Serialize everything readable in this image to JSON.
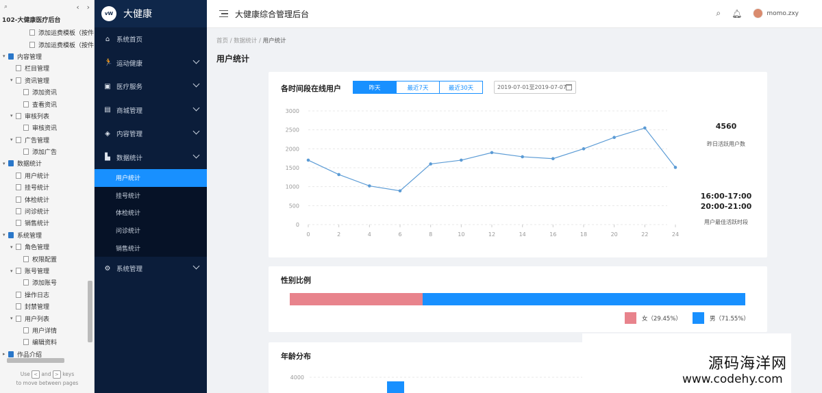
{
  "tree": {
    "project": "102-大健康医疗后台",
    "nodes": [
      {
        "label": "添加运费模板（按件",
        "level": 3,
        "type": "page"
      },
      {
        "label": "添加运费模板（按件",
        "level": 3,
        "type": "page"
      },
      {
        "label": "内容管理",
        "level": 0,
        "type": "folder",
        "toggle": "▾"
      },
      {
        "label": "栏目管理",
        "level": 1,
        "type": "page"
      },
      {
        "label": "资讯管理",
        "level": 1,
        "type": "page",
        "toggle": "▾"
      },
      {
        "label": "添加资讯",
        "level": 2,
        "type": "page"
      },
      {
        "label": "查看资讯",
        "level": 2,
        "type": "page"
      },
      {
        "label": "审核列表",
        "level": 1,
        "type": "page",
        "toggle": "▾"
      },
      {
        "label": "审核资讯",
        "level": 2,
        "type": "page"
      },
      {
        "label": "广告管理",
        "level": 1,
        "type": "page",
        "toggle": "▾"
      },
      {
        "label": "添加广告",
        "level": 2,
        "type": "page"
      },
      {
        "label": "数据统计",
        "level": 0,
        "type": "folder",
        "toggle": "▾"
      },
      {
        "label": "用户统计",
        "level": 1,
        "type": "page"
      },
      {
        "label": "挂号统计",
        "level": 1,
        "type": "page"
      },
      {
        "label": "体检统计",
        "level": 1,
        "type": "page"
      },
      {
        "label": "问诊统计",
        "level": 1,
        "type": "page"
      },
      {
        "label": "销售统计",
        "level": 1,
        "type": "page"
      },
      {
        "label": "系统管理",
        "level": 0,
        "type": "folder",
        "toggle": "▾"
      },
      {
        "label": "角色管理",
        "level": 1,
        "type": "page",
        "toggle": "▾"
      },
      {
        "label": "权限配置",
        "level": 2,
        "type": "page"
      },
      {
        "label": "账号管理",
        "level": 1,
        "type": "page",
        "toggle": "▾"
      },
      {
        "label": "添加账号",
        "level": 2,
        "type": "page"
      },
      {
        "label": "操作日志",
        "level": 1,
        "type": "page"
      },
      {
        "label": "封禁管理",
        "level": 1,
        "type": "page"
      },
      {
        "label": "用户列表",
        "level": 1,
        "type": "page",
        "toggle": "▾"
      },
      {
        "label": "用户详情",
        "level": 2,
        "type": "page"
      },
      {
        "label": "编辑资料",
        "level": 2,
        "type": "page"
      },
      {
        "label": "作品介绍",
        "level": 0,
        "type": "folder",
        "toggle": "▸"
      }
    ],
    "footer_use": "Use",
    "footer_and": "and",
    "footer_keys": "keys",
    "footer_line2": "to move between pages",
    "key_left": "<",
    "key_right": ">"
  },
  "sidebar": {
    "brand": "大健康",
    "logo_text": "vW",
    "items_top": [
      {
        "label": "系统首页",
        "icon": "⌂",
        "icon_name": "home-icon",
        "chevron": false
      },
      {
        "label": "运动健康",
        "icon": "🏃",
        "icon_name": "running-icon",
        "chevron": true
      },
      {
        "label": "医疗服务",
        "icon": "▣",
        "icon_name": "medical-kit-icon",
        "chevron": true
      },
      {
        "label": "商城管理",
        "icon": "▤",
        "icon_name": "shop-icon",
        "chevron": true
      },
      {
        "label": "内容管理",
        "icon": "◈",
        "icon_name": "box-icon",
        "chevron": true
      },
      {
        "label": "数据统计",
        "icon": "▙",
        "icon_name": "bar-chart-icon",
        "chevron": true
      }
    ],
    "submenu": [
      "用户统计",
      "挂号统计",
      "体检统计",
      "问诊统计",
      "销售统计"
    ],
    "submenu_active": 0,
    "items_bottom": [
      {
        "label": "系统管理",
        "icon": "⚙",
        "icon_name": "gear-icon",
        "chevron": true
      }
    ]
  },
  "header": {
    "title": "大健康综合管理后台",
    "username": "momo.zxy"
  },
  "breadcrumb": {
    "home": "首页",
    "sep": "/",
    "level2": "数据统计",
    "current": "用户统计"
  },
  "page_title": "用户统计",
  "online": {
    "title": "各时间段在线用户",
    "tabs": [
      "昨天",
      "最近7天",
      "最近30天"
    ],
    "active_tab": 0,
    "date_range": "2019-07-01至2019-07-07",
    "stat1_value": "4560",
    "stat1_caption": "昨日活跃用户数",
    "stat2_line1": "16:00-17:00",
    "stat2_line2": "20:00-21:00",
    "stat2_caption": "用户最佳活跃时段"
  },
  "gender": {
    "title": "性别比例",
    "female_label": "女（29.45%）",
    "male_label": "男（71.55%）",
    "female_pct": 29.45,
    "male_pct": 71.55,
    "female_color": "#e8838c",
    "male_color": "#1890ff"
  },
  "age": {
    "title": "年龄分布",
    "first_tick": "4000"
  },
  "watermark": {
    "line1": "源码海洋网",
    "line2": "www.codehy.com"
  },
  "chart_data": [
    {
      "type": "line",
      "title": "各时间段在线用户",
      "x": [
        0,
        2,
        4,
        6,
        8,
        10,
        12,
        14,
        16,
        18,
        20,
        22,
        24
      ],
      "series": [
        {
          "values": [
            1700,
            1320,
            1020,
            890,
            1600,
            1700,
            1900,
            1790,
            1740,
            2000,
            2300,
            2550,
            1510
          ]
        }
      ],
      "xticks": [
        "0",
        "2",
        "4",
        "6",
        "8",
        "10",
        "12",
        "14",
        "16",
        "18",
        "20",
        "22",
        "24"
      ],
      "yticks": [
        "0",
        "500",
        "1000",
        "1500",
        "2000",
        "2500",
        "3000"
      ],
      "xlim": [
        0,
        24
      ],
      "ylim": [
        0,
        3000
      ],
      "grid": true,
      "color": "#5b9bd5"
    },
    {
      "type": "bar",
      "title": "性别比例",
      "categories": [
        "女",
        "男"
      ],
      "values": [
        29.45,
        71.55
      ],
      "colors": [
        "#e8838c",
        "#1890ff"
      ]
    }
  ]
}
